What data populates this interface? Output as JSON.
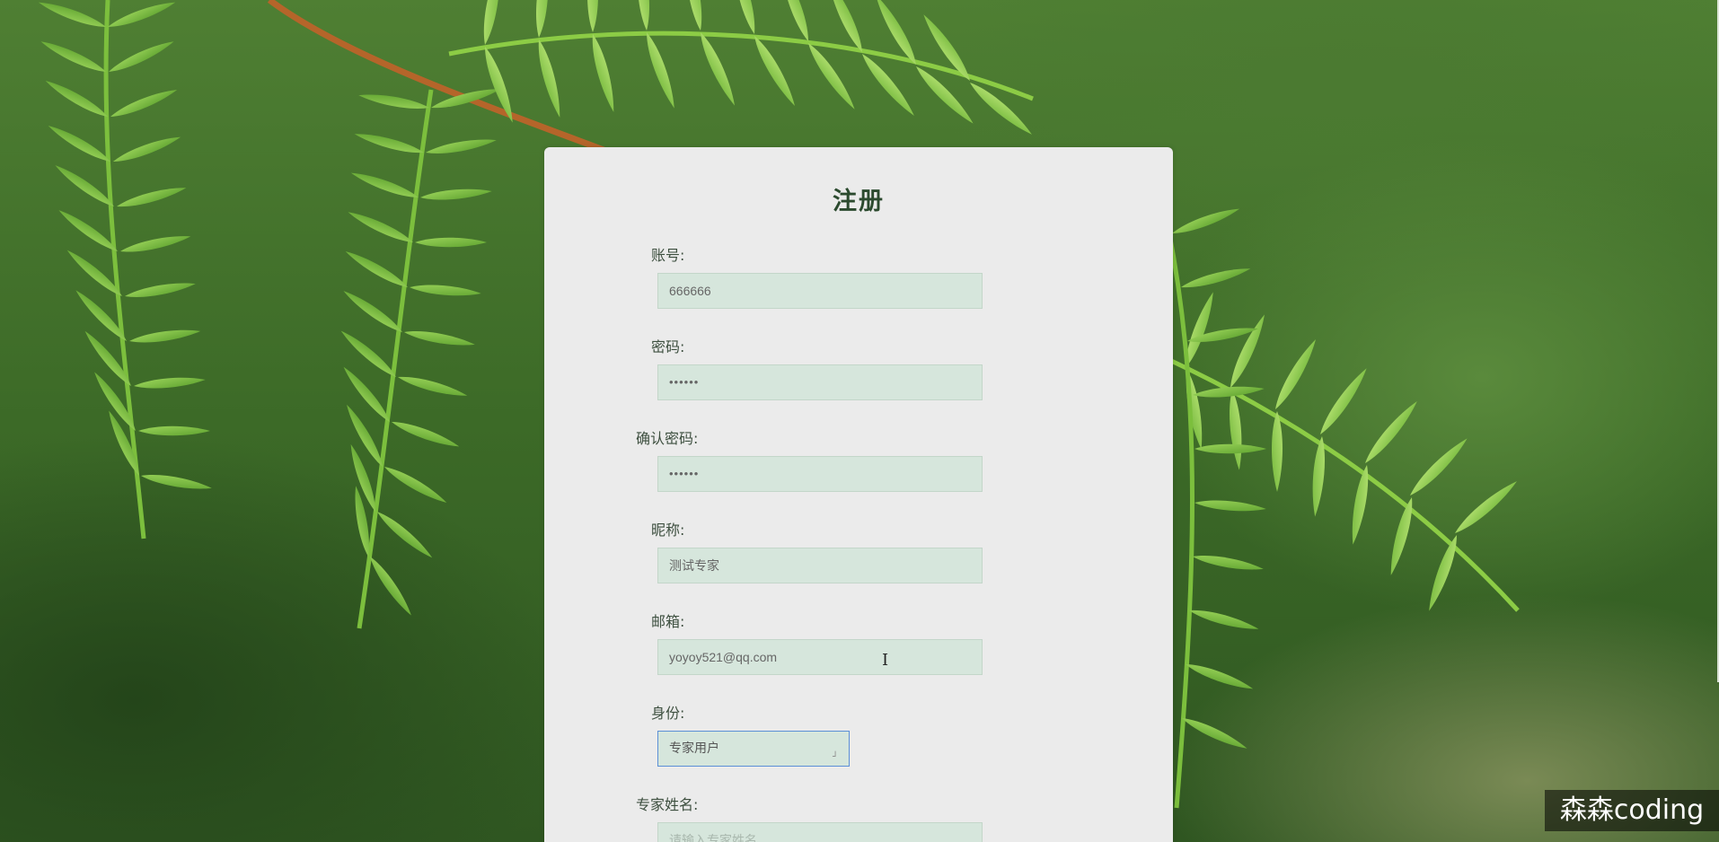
{
  "form": {
    "title": "注册",
    "fields": [
      {
        "label": "账号:",
        "value": "666666",
        "placeholder": ""
      },
      {
        "label": "密码:",
        "value": "••••••",
        "placeholder": ""
      },
      {
        "label": "确认密码:",
        "value": "••••••",
        "placeholder": ""
      },
      {
        "label": "昵称:",
        "value": "测试专家",
        "placeholder": ""
      },
      {
        "label": "邮箱:",
        "value": "yoyoy521@qq.com",
        "placeholder": ""
      },
      {
        "label": "身份:",
        "value": "专家用户",
        "placeholder": ""
      },
      {
        "label": "专家姓名:",
        "value": "",
        "placeholder": "请输入专家姓名"
      }
    ]
  },
  "watermark": {
    "text": "森森coding"
  },
  "colors": {
    "card_background": "#ebebeb",
    "input_background": "#d6e6dc",
    "title_color": "#2b4a2e",
    "select_focus_border": "#5b8fd6"
  },
  "icons": {
    "select_arrow": "chevron-down-icon",
    "cursor": "text-cursor-icon"
  }
}
